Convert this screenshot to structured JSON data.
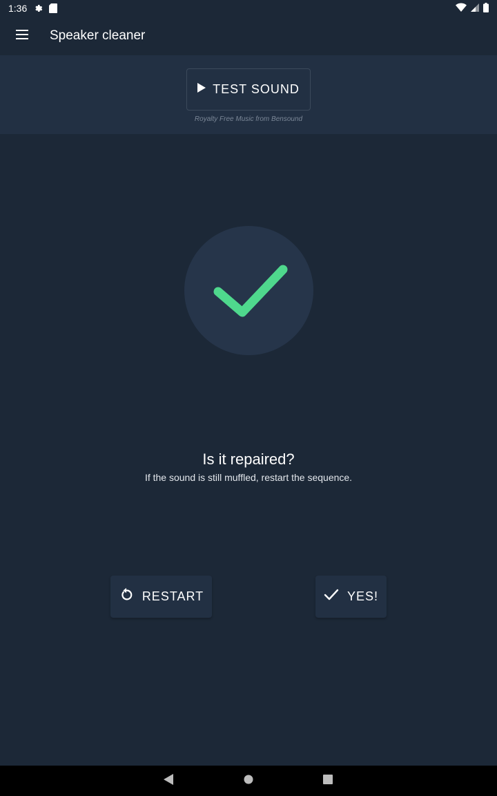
{
  "status_bar": {
    "time": "1:36",
    "icons": [
      "gear-icon",
      "sd-card-icon",
      "wifi-icon",
      "signal-icon",
      "battery-icon"
    ]
  },
  "app_bar": {
    "title": "Speaker cleaner",
    "menu_icon": "menu-icon"
  },
  "test_panel": {
    "button_label": "TEST SOUND",
    "button_icon": "play-icon",
    "credit": "Royalty Free Music from Bensound"
  },
  "result": {
    "icon": "checkmark-icon",
    "check_color": "#4fd88d",
    "question": "Is it repaired?",
    "hint": "If the sound is still muffled, restart the sequence."
  },
  "actions": {
    "restart_label": "RESTART",
    "restart_icon": "restart-icon",
    "yes_label": "YES!",
    "yes_icon": "check-icon"
  },
  "nav_bar": {
    "icons": [
      "back-icon",
      "home-icon",
      "recents-icon"
    ]
  },
  "colors": {
    "background": "#1c2837",
    "panel": "#223043",
    "circle": "#26354a",
    "accent_green": "#4fd88d"
  }
}
